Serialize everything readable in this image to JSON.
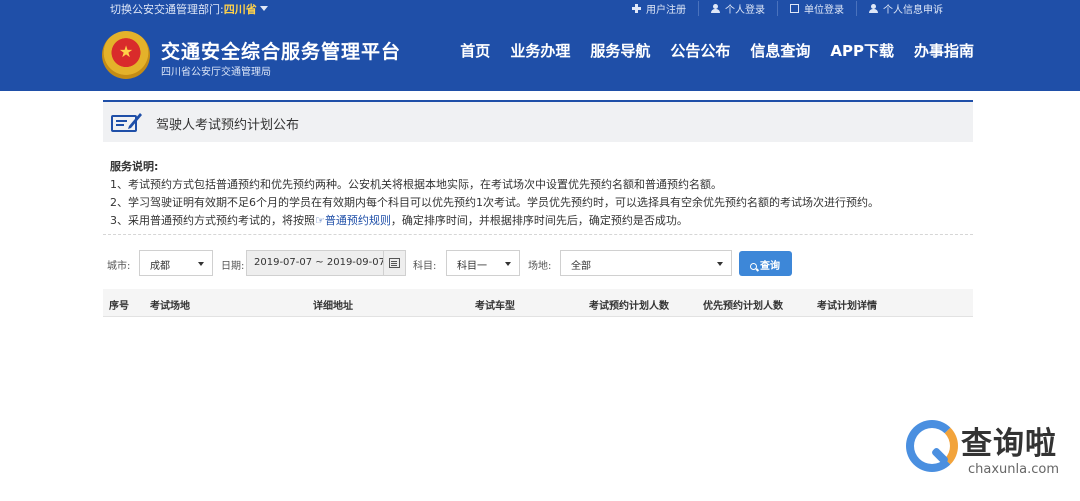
{
  "topbar": {
    "dept_prefix": "切换公安交通管理部门:",
    "dept_name": "四川省",
    "links": [
      {
        "label": "用户注册",
        "icon": "plus-icon"
      },
      {
        "label": "个人登录",
        "icon": "user-icon"
      },
      {
        "label": "单位登录",
        "icon": "building-icon"
      },
      {
        "label": "个人信息申诉",
        "icon": "user-icon"
      }
    ]
  },
  "header": {
    "title": "交通安全综合服务管理平台",
    "subtitle": "四川省公安厅交通管理局",
    "nav": [
      "首页",
      "业务办理",
      "服务导航",
      "公告公布",
      "信息查询",
      "APP下载",
      "办事指南"
    ]
  },
  "section": {
    "title": "驾驶人考试预约计划公布"
  },
  "description": {
    "heading": "服务说明:",
    "line1": "1、考试预约方式包括普通预约和优先预约两种。公安机关将根据本地实际，在考试场次中设置优先预约名额和普通预约名额。",
    "line2": "2、学习驾驶证明有效期不足6个月的学员在有效期内每个科目可以优先预约1次考试。学员优先预约时，可以选择具有空余优先预约名额的考试场次进行预约。",
    "line3_before": "3、采用普通预约方式预约考试的，将按照",
    "line3_link": "☞普通预约规则",
    "line3_after": "，确定排序时间，并根据排序时间先后，确定预约是否成功。"
  },
  "filters": {
    "city_label": "城市:",
    "city_value": "成都",
    "date_label": "日期:",
    "date_value": "2019-07-07 ~ 2019-09-07",
    "subject_label": "科目:",
    "subject_value": "科目一",
    "venue_label": "场地:",
    "venue_value": "全部",
    "search_label": "查询"
  },
  "table": {
    "columns": [
      "序号",
      "考试场地",
      "详细地址",
      "考试车型",
      "考试预约计划人数",
      "优先预约计划人数",
      "考试计划详情"
    ]
  },
  "watermark": {
    "text": "查询啦",
    "url": "chaxunla.com"
  },
  "colors": {
    "brand_blue": "#1f4fa8",
    "accent_yellow": "#ffd24a",
    "button_blue": "#3d87d8"
  }
}
